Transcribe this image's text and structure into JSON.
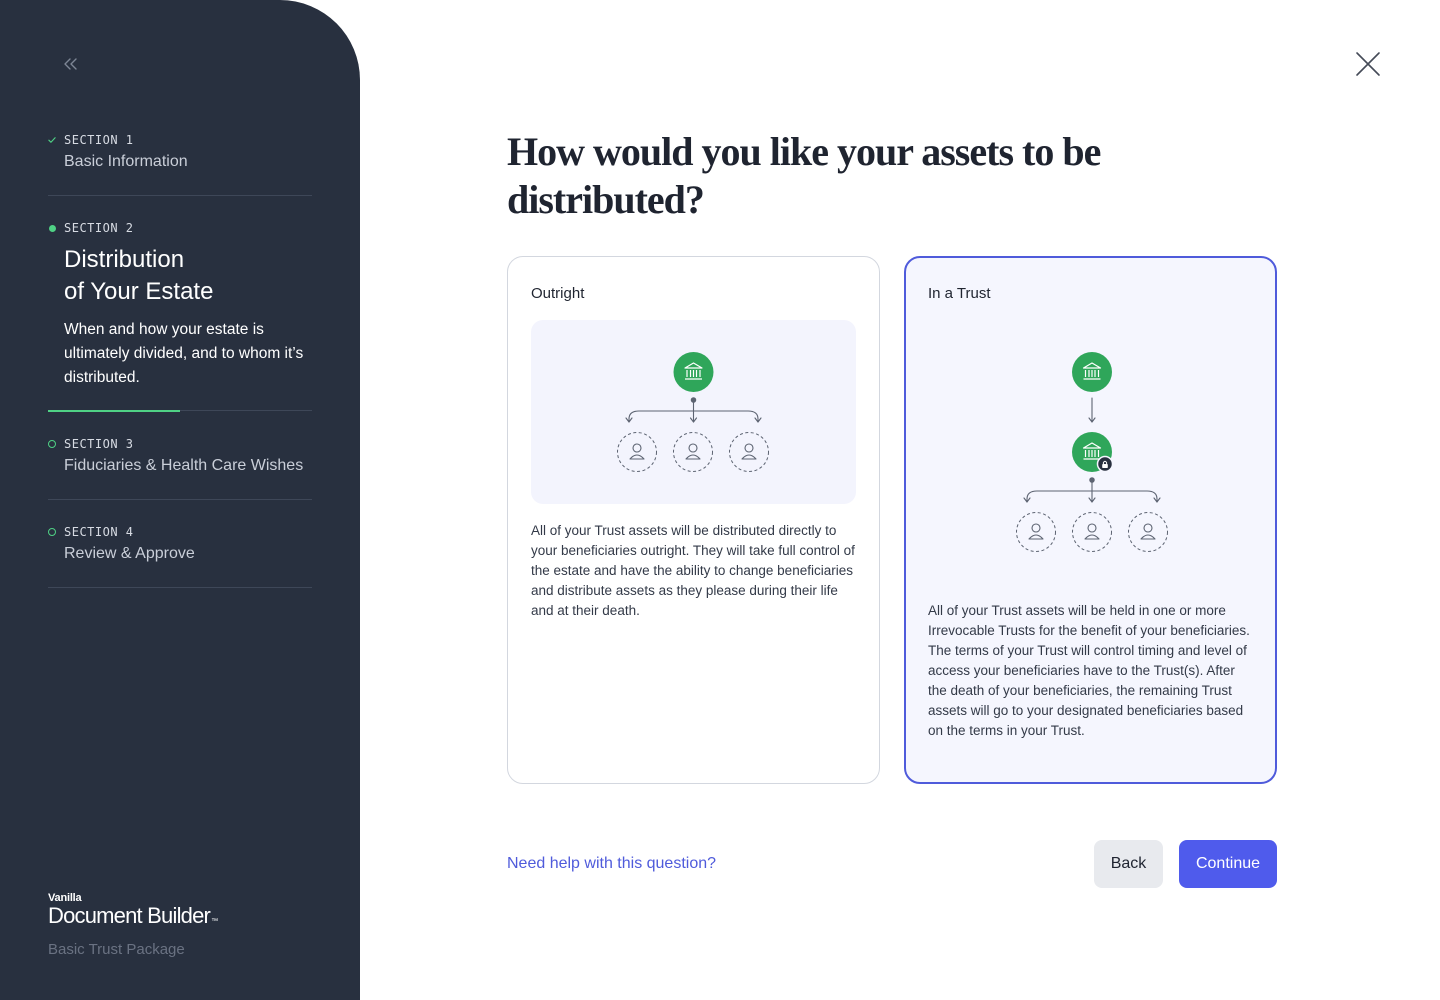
{
  "sidebar": {
    "sections": [
      {
        "label": "SECTION 1",
        "title": "Basic Information",
        "state": "complete"
      },
      {
        "label": "SECTION 2",
        "title": "Distribution\nof Your Estate",
        "description": "When and how your estate is ultimately divided, and to whom it’s distributed.",
        "state": "active"
      },
      {
        "label": "SECTION 3",
        "title": "Fiduciaries & Health Care Wishes",
        "state": "upcoming"
      },
      {
        "label": "SECTION 4",
        "title": "Review & Approve",
        "state": "upcoming"
      }
    ],
    "brand": {
      "company": "Vanilla",
      "product": "Document Builder",
      "trademark": "™",
      "package": "Basic Trust Package"
    }
  },
  "main": {
    "question": "How would you like your assets to be distributed?",
    "options": [
      {
        "title": "Outright",
        "selected": false,
        "description": "All of your Trust assets will be distributed directly to your beneficiaries outright. They will take full control of the estate and have the ability to change beneficiaries and distribute assets as they please during their life and at their death."
      },
      {
        "title": "In a Trust",
        "selected": true,
        "description": "All of your Trust assets will be held in one or more Irrevocable Trusts for the benefit of your beneficiaries. The terms of your Trust will control timing and level of access your beneficiaries have to the Trust(s). After the death of your beneficiaries, the remaining Trust assets will go to your designated beneficiaries based on the terms in your Trust."
      }
    ],
    "help_link": "Need help with this question?",
    "back_label": "Back",
    "continue_label": "Continue"
  },
  "icons": {
    "collapse": "double-chevron-left-icon",
    "close": "close-icon",
    "check": "check-icon",
    "bank": "bank-icon",
    "person": "person-icon",
    "lock": "lock-icon"
  },
  "colors": {
    "sidebar_bg": "#28303f",
    "accent_green": "#4fd185",
    "icon_green": "#2fa65a",
    "primary": "#4f5bec",
    "selected_border": "#4f5bdb"
  }
}
